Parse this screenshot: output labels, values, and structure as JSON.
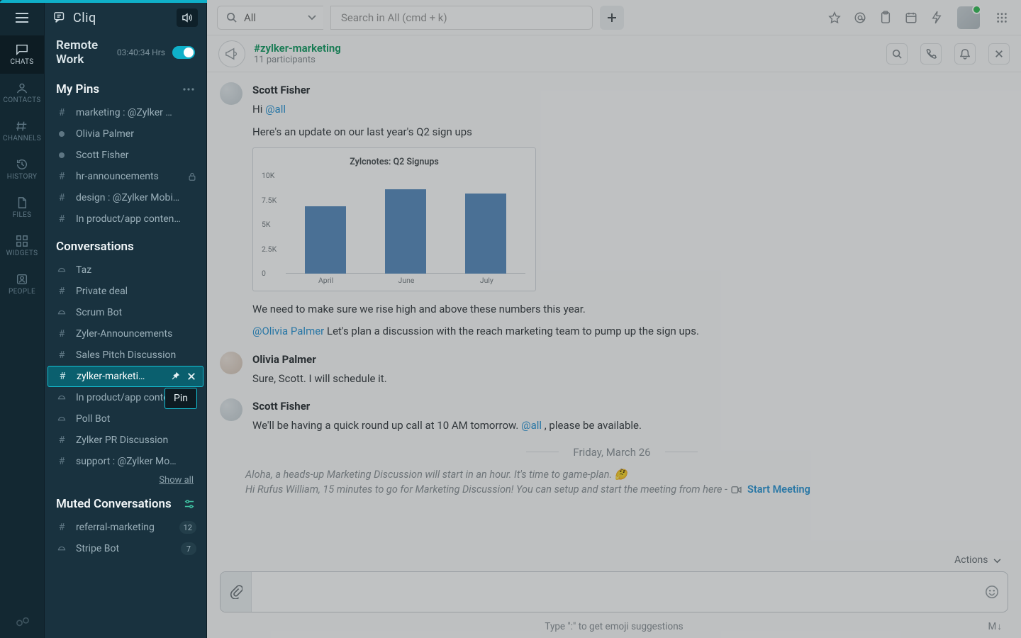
{
  "app": {
    "name": "Cliq"
  },
  "leftrail": {
    "items": [
      {
        "key": "chats",
        "label": "CHATS"
      },
      {
        "key": "contacts",
        "label": "CONTACTS"
      },
      {
        "key": "channels",
        "label": "CHANNELS"
      },
      {
        "key": "history",
        "label": "HISTORY"
      },
      {
        "key": "files",
        "label": "FILES"
      },
      {
        "key": "widgets",
        "label": "WIDGETS"
      },
      {
        "key": "people",
        "label": "PEOPLE"
      }
    ],
    "active": "chats"
  },
  "remote": {
    "title": "Remote Work",
    "timer": "03:40:34 Hrs",
    "enabled": true
  },
  "pins": {
    "header": "My Pins",
    "items": [
      {
        "type": "channel",
        "label": "marketing : @Zylker …"
      },
      {
        "type": "dm",
        "label": "Olivia Palmer"
      },
      {
        "type": "dm",
        "label": "Scott Fisher"
      },
      {
        "type": "channel",
        "label": "hr-announcements",
        "locked": true
      },
      {
        "type": "channel",
        "label": "design : @Zylker Mobi…"
      },
      {
        "type": "channel",
        "label": "In product/app conten…"
      }
    ]
  },
  "conversations": {
    "header": "Conversations",
    "items": [
      {
        "type": "bot",
        "label": "Taz"
      },
      {
        "type": "channel",
        "label": "Private deal"
      },
      {
        "type": "bot",
        "label": "Scrum Bot"
      },
      {
        "type": "channel",
        "label": "Zyler-Announcements"
      },
      {
        "type": "channel",
        "label": "Sales Pitch Discussion"
      },
      {
        "type": "channel",
        "label": "zylker-marketi…",
        "selected": true
      },
      {
        "type": "bot",
        "label": "In product/app conten…"
      },
      {
        "type": "bot",
        "label": "Poll Bot"
      },
      {
        "type": "channel",
        "label": "Zylker PR Discussion"
      },
      {
        "type": "channel",
        "label": "support : @Zylker Mo…"
      }
    ],
    "show_all": "Show all"
  },
  "muted": {
    "header": "Muted Conversations",
    "items": [
      {
        "type": "channel",
        "label": "referral-marketing",
        "badge": "12"
      },
      {
        "type": "bot",
        "label": "Stripe Bot",
        "badge": "7"
      }
    ]
  },
  "tooltip": {
    "pin": "Pin"
  },
  "topbar": {
    "scope": "All",
    "search_placeholder": "Search in All (cmd + k)"
  },
  "channel": {
    "name": "#zylker-marketing",
    "participants": "11 participants"
  },
  "messages": {
    "m1": {
      "author": "Scott Fisher",
      "line1_a": "Hi ",
      "line1_b": "@all",
      "line2": "Here's an update on our last year's Q2 sign ups",
      "line3": "We need to make sure we rise high and above these numbers this year.",
      "line4_a": "@Olivia Palmer",
      "line4_b": " Let's plan a discussion with the reach marketing team to pump up the sign ups."
    },
    "m2": {
      "author": "Olivia Palmer",
      "line1": "Sure, Scott. I will schedule it."
    },
    "m3": {
      "author": "Scott Fisher",
      "line1_a": "We'll be having a quick round up call at 10 AM tomorrow. ",
      "line1_b": "@all",
      "line1_c": " , please be available."
    },
    "divider": "Friday, March 26",
    "sys1": "Aloha, a heads-up Marketing Discussion will start in an hour.  It's time to game-plan. 🤔",
    "sys2_a": "Hi Rufus William, 15 minutes to go for Marketing Discussion! You can setup and start the meeting from here",
    "sys2_dash": " - ",
    "sys2_link": "Start Meeting"
  },
  "composer": {
    "actions_label": "Actions",
    "hint": "Type \":\" to get emoji suggestions",
    "md": "M↓"
  },
  "chart_data": {
    "type": "bar",
    "title": "Zylcnotes: Q2 Signups",
    "categories": [
      "April",
      "June",
      "July"
    ],
    "values": [
      6900,
      8600,
      8200
    ],
    "yticks": [
      0,
      2500,
      5000,
      7500,
      10000
    ],
    "ytick_labels": [
      "0",
      "2.5K",
      "5K",
      "7.5K",
      "10K"
    ],
    "ylim": [
      0,
      10000
    ],
    "xlabel": "",
    "ylabel": ""
  }
}
